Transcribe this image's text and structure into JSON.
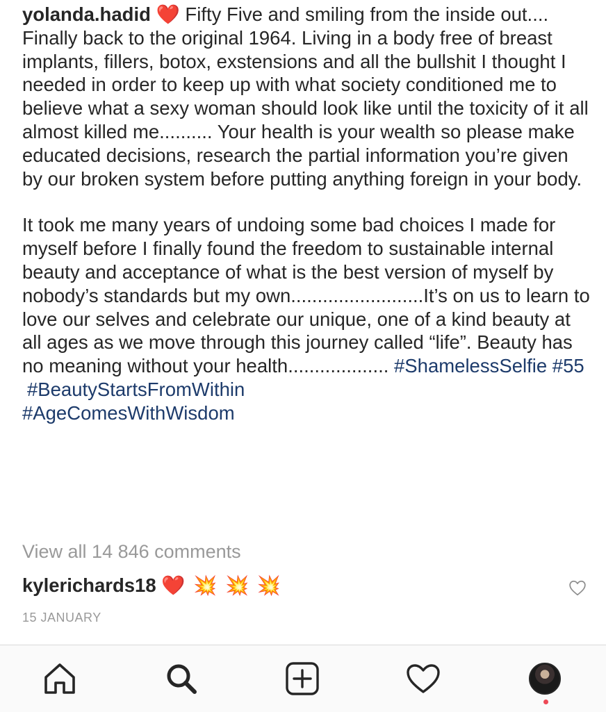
{
  "post": {
    "username": "yolanda.hadid",
    "heart": "❤️",
    "caption_p1": "Fifty Five and smiling from the inside out.... Finally back to the original 1964. Living in a body free of breast implants, fillers, botox, exstensions and all the bullshit I thought I needed in order to keep up with what society conditioned me to believe what a sexy woman should look like until the toxicity of it all almost killed me.......... Your health is your wealth so please make educated decisions,  research the partial information you’re given by our broken system before putting anything foreign in your body.",
    "caption_p2": "It took me many years of undoing some bad choices I made for myself before I finally found the freedom to sustainable internal beauty and acceptance of what is the best version of myself by nobody’s standards but my own.........................It’s on us to learn to love our selves and celebrate our unique, one of a kind beauty at all ages as we move through this journey called “life”. Beauty has no meaning without your health...................",
    "hashtags": [
      "#ShamelessSelfie",
      "#55",
      "#BeautyStartsFromWithin",
      "#AgeComesWithWisdom"
    ],
    "view_all_comments": "View all 14 846 comments",
    "date": "15 JANUARY"
  },
  "comment": {
    "username": "kylerichards18",
    "emojis": "❤️ 💥 💥 💥"
  },
  "tabbar": {
    "items": [
      {
        "icon": "home-icon"
      },
      {
        "icon": "search-icon"
      },
      {
        "icon": "add-post-icon"
      },
      {
        "icon": "heart-activity-icon"
      },
      {
        "icon": "profile-avatar"
      }
    ]
  },
  "colors": {
    "hashtag": "#1d3b6b",
    "muted": "#999999",
    "notification_dot": "#ed4956"
  }
}
